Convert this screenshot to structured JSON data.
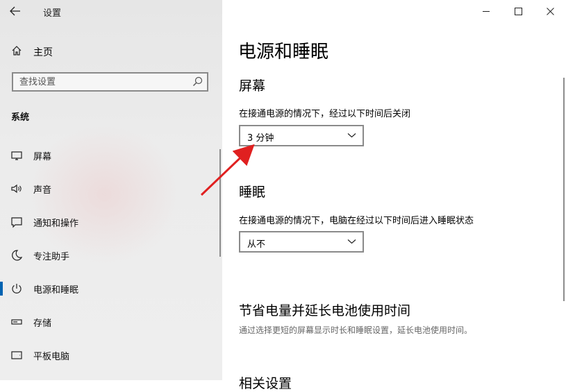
{
  "app": {
    "title": "设置"
  },
  "sidebar": {
    "home_label": "主页",
    "search_placeholder": "查找设置",
    "section_title": "系统",
    "items": [
      {
        "label": "屏幕",
        "icon": "monitor-icon"
      },
      {
        "label": "声音",
        "icon": "speaker-icon"
      },
      {
        "label": "通知和操作",
        "icon": "notification-icon"
      },
      {
        "label": "专注助手",
        "icon": "moon-icon"
      },
      {
        "label": "电源和睡眠",
        "icon": "power-icon",
        "active": true
      },
      {
        "label": "存储",
        "icon": "storage-icon"
      },
      {
        "label": "平板电脑",
        "icon": "tablet-icon"
      }
    ]
  },
  "main": {
    "title": "电源和睡眠",
    "screen": {
      "heading": "屏幕",
      "description": "在接通电源的情况下，经过以下时间后关闭",
      "selected": "3 分钟"
    },
    "sleep": {
      "heading": "睡眠",
      "description": "在接通电源的情况下，电脑在经过以下时间后进入睡眠状态",
      "selected": "从不"
    },
    "battery": {
      "heading": "节省电量并延长电池使用时间",
      "description": "通过选择更短的屏幕显示时长和睡眠设置，延长电池使用时间。"
    },
    "related_heading_partial": "相关设置"
  },
  "colors": {
    "accent": "#0063b1",
    "annotation_arrow": "#e02020"
  }
}
